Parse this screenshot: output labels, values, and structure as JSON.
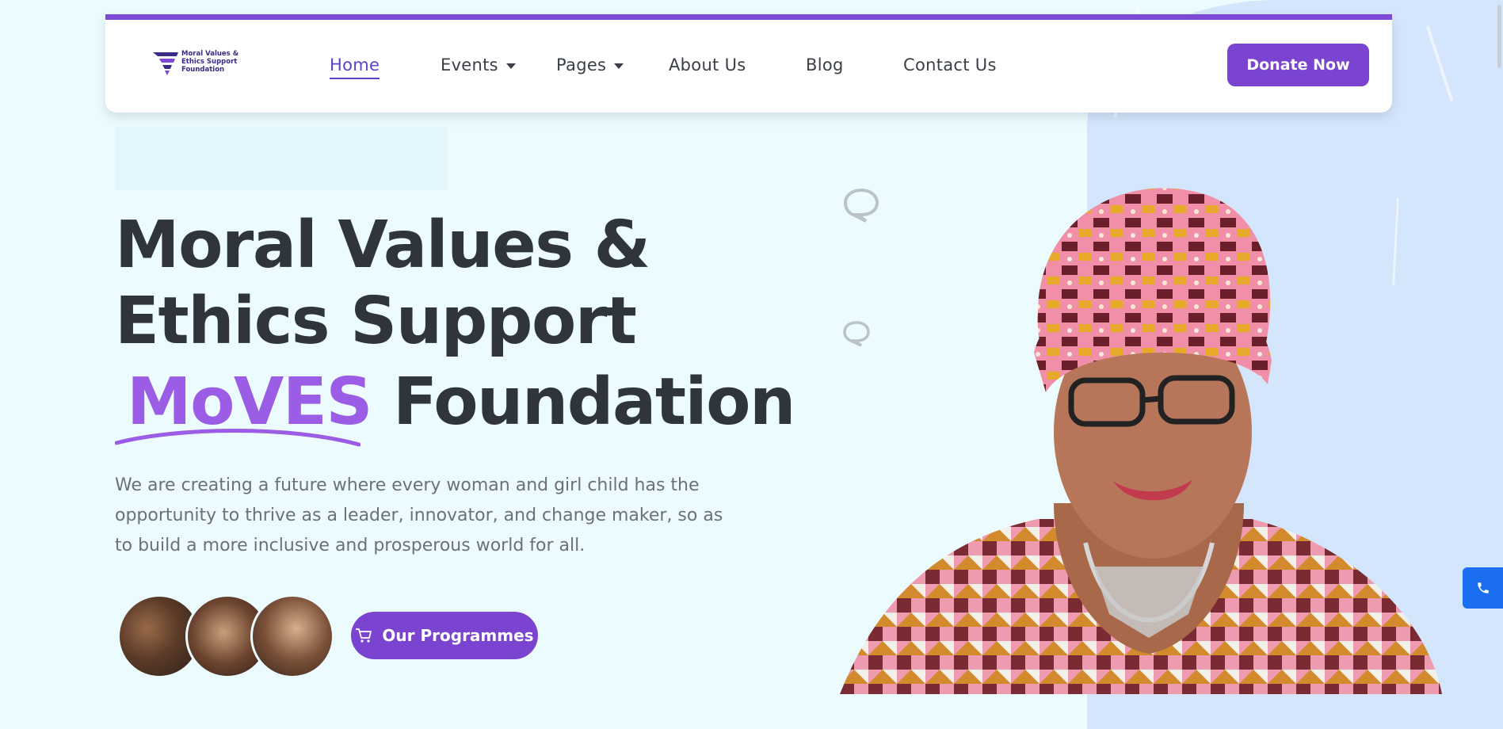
{
  "brand": {
    "logo_lines": [
      "Moral Values &",
      "Ethics Support",
      "Foundation"
    ],
    "accent_color": "#7e49d6",
    "button_color": "#7a44d0"
  },
  "nav": {
    "items": [
      {
        "label": "Home",
        "active": true
      },
      {
        "label": "Events",
        "dropdown": true
      },
      {
        "label": "Pages",
        "dropdown": true
      },
      {
        "label": "About Us"
      },
      {
        "label": "Blog"
      },
      {
        "label": "Contact Us"
      }
    ],
    "donate_label": "Donate Now"
  },
  "hero": {
    "title_line1": "Moral Values &",
    "title_line2": "Ethics Support",
    "title_accent": "MoVES",
    "title_line3_rest": "Foundation",
    "description": "We are creating a future where every woman and girl child has the opportunity to thrive as a leader, innovator, and change maker, so as to build a more inclusive and prosperous world for all.",
    "cta_label": "Our Programmes",
    "cta_icon": "cart-icon"
  },
  "icons": {
    "chat_bubble": "chat-bubble-icon",
    "phone": "phone-icon"
  }
}
